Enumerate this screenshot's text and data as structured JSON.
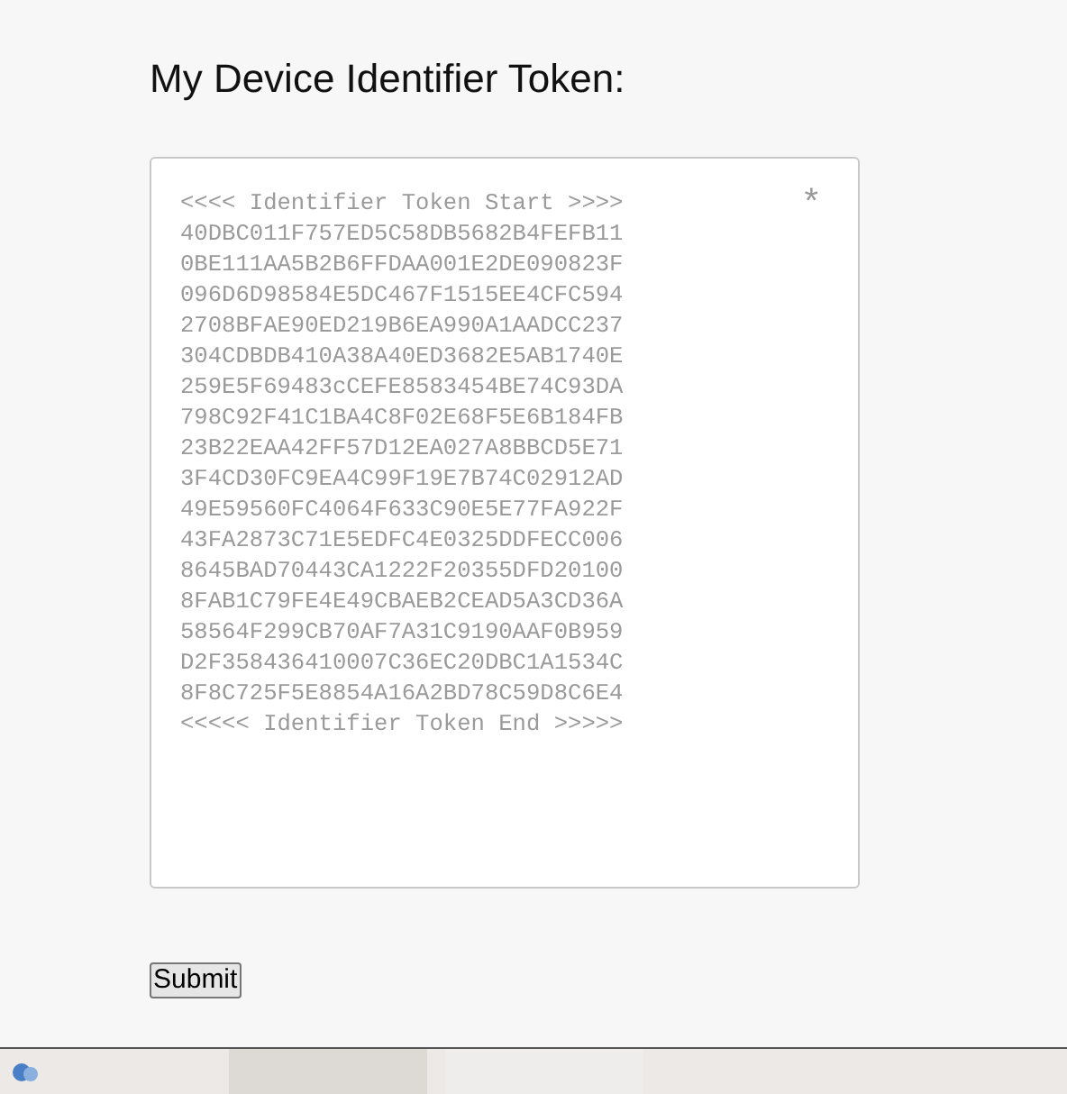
{
  "heading": "My Device Identifier Token:",
  "token_field": {
    "required_mark": "*",
    "lines": [
      "<<<< Identifier Token Start >>>>",
      "40DBC011F757ED5C58DB5682B4FEFB11",
      "0BE111AA5B2B6FFDAA001E2DE090823F",
      "096D6D98584E5DC467F1515EE4CFC594",
      "2708BFAE90ED219B6EA990A1AADCC237",
      "304CDBDB410A38A40ED3682E5AB1740E",
      "259E5F69483cCEFE8583454BE74C93DA",
      "798C92F41C1BA4C8F02E68F5E6B184FB",
      "23B22EAA42FF57D12EA027A8BBCD5E71",
      "3F4CD30FC9EA4C99F19E7B74C02912AD",
      "49E59560FC4064F633C90E5E77FA922F",
      "43FA2873C71E5EDFC4E0325DDFECC006",
      "8645BAD70443CA1222F20355DFD20100",
      "8FAB1C79FE4E49CBAEB2CEAD5A3CD36A",
      "58564F299CB70AF7A31C9190AAF0B959",
      "D2F358436410007C36EC20DBC1A1534C",
      "8F8C725F5E8854A16A2BD78C59D8C6E4",
      "<<<<< Identifier Token End >>>>>"
    ]
  },
  "submit_button": "Submit"
}
